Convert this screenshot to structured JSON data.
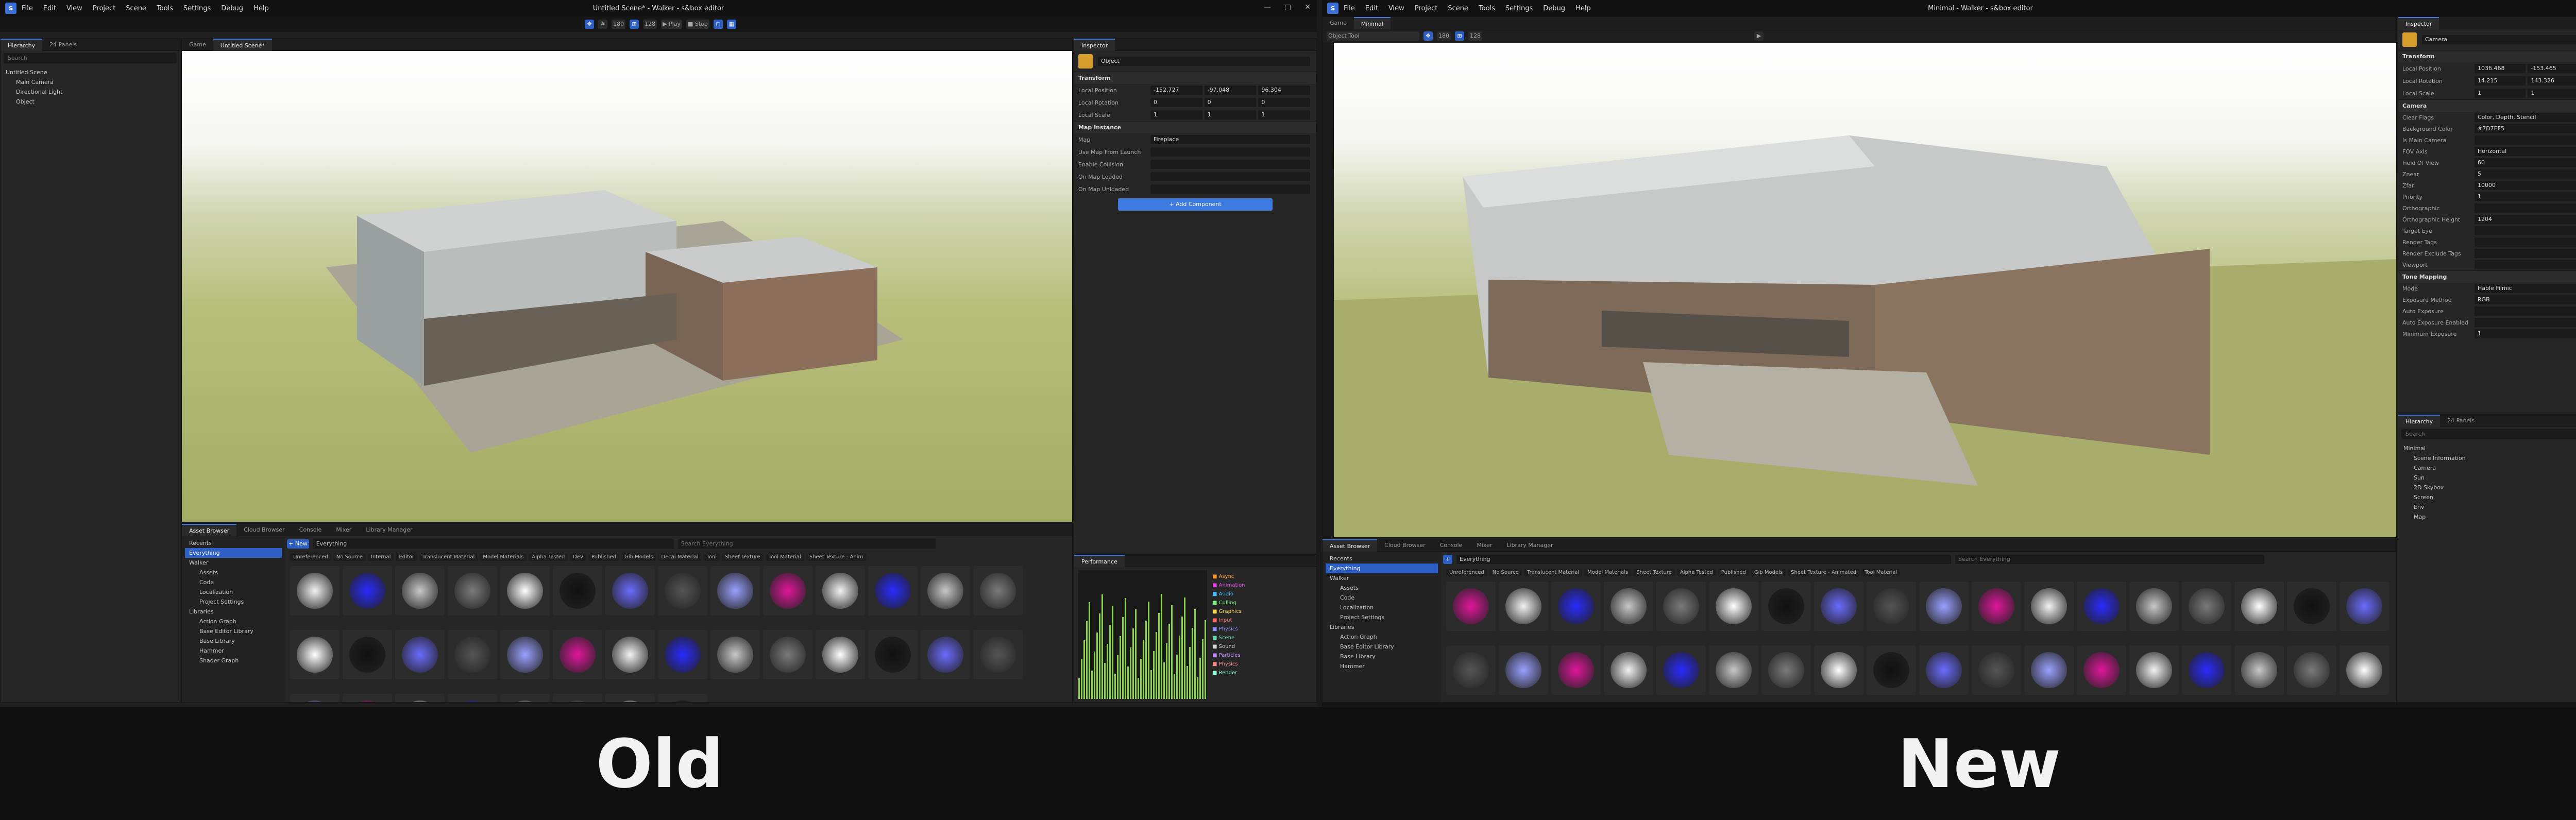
{
  "old": {
    "title": "Untitled Scene* - Walker - s&box editor",
    "menu": [
      "File",
      "Edit",
      "View",
      "Project",
      "Scene",
      "Tools",
      "Settings",
      "Debug",
      "Help"
    ],
    "toolbar": {
      "grid": "180",
      "snap": "128",
      "play": "Play",
      "stop": "Stop"
    },
    "hierarchy": {
      "tab": "Hierarchy",
      "tab2": "24 Panels",
      "search_placeholder": "Search",
      "items": [
        "Untitled Scene",
        "Main Camera",
        "Directional Light",
        "Object"
      ]
    },
    "viewport_tabs": [
      "Game",
      "Untitled Scene*"
    ],
    "inspector": {
      "tab": "Inspector",
      "object_name": "Object",
      "transform_label": "Transform",
      "rows": [
        {
          "label": "Local Position",
          "x": "-152.727",
          "y": "-97.048",
          "z": "96.304"
        },
        {
          "label": "Local Rotation",
          "x": "0",
          "y": "0",
          "z": "0"
        },
        {
          "label": "Local Scale",
          "x": "1",
          "y": "1",
          "z": "1"
        }
      ],
      "map_instance_label": "Map Instance",
      "map_rows": [
        {
          "label": "Map",
          "value": "Fireplace"
        },
        {
          "label": "Use Map From Launch",
          "value": ""
        },
        {
          "label": "Enable Collision",
          "value": ""
        },
        {
          "label": "On Map Loaded",
          "value": ""
        },
        {
          "label": "On Map Unloaded",
          "value": ""
        }
      ],
      "add_component": "+ Add Component"
    },
    "asset_browser": {
      "tabs": [
        "Asset Browser",
        "Cloud Browser",
        "Console",
        "Mixer",
        "Library Manager"
      ],
      "left": [
        "Recents",
        "Everything",
        "Walker",
        "Assets",
        "Code",
        "Localization",
        "Project Settings",
        "Libraries",
        "Action Graph",
        "Base Editor Library",
        "Base Library",
        "Hammer",
        "Shader Graph"
      ],
      "path": "Everything",
      "search_placeholder": "Search Everything",
      "filters": [
        "Unreferenced",
        "No Source",
        "Internal",
        "Editor",
        "Translucent Material",
        "Model Materials",
        "Alpha Tested",
        "Dev",
        "Published",
        "Gib Models",
        "Decal Material",
        "Tool",
        "Sheet Texture",
        "Tool Material",
        "Sheet Texture - Anim"
      ]
    },
    "performance": {
      "tab": "Performance",
      "legend": [
        "Async",
        "Animation",
        "Audio",
        "Culling",
        "Graphics",
        "Input",
        "Physics",
        "Scene",
        "Sound",
        "Particles",
        "Physics",
        "Render"
      ]
    },
    "caption": "Old"
  },
  "new": {
    "title": "Minimal - Walker - s&box editor",
    "menu": [
      "File",
      "Edit",
      "View",
      "Project",
      "Scene",
      "Tools",
      "Settings",
      "Debug",
      "Help"
    ],
    "viewport_tabs": [
      "Game",
      "Minimal"
    ],
    "tool_label": "Object Tool",
    "toolbar": {
      "grid": "180",
      "snap": "128"
    },
    "inspector": {
      "tab": "Inspector",
      "object_name": "Camera",
      "transform_label": "Transform",
      "rows": [
        {
          "label": "Local Position",
          "x": "1036.468",
          "y": "-153.465",
          "z": "1040.75"
        },
        {
          "label": "Local Rotation",
          "x": "14.215",
          "y": "143.326",
          "z": "0"
        },
        {
          "label": "Local Scale",
          "x": "1",
          "y": "1",
          "z": "1"
        }
      ],
      "camera_label": "Camera",
      "camera_rows": [
        {
          "label": "Clear Flags",
          "value": "Color, Depth, Stencil"
        },
        {
          "label": "Background Color",
          "value": "#7D7EF5"
        },
        {
          "label": "Is Main Camera",
          "value": ""
        },
        {
          "label": "FOV Axis",
          "value": "Horizontal"
        },
        {
          "label": "Field Of View",
          "value": "60"
        },
        {
          "label": "Znear",
          "value": "5"
        },
        {
          "label": "Zfar",
          "value": "10000"
        },
        {
          "label": "Priority",
          "value": "1"
        },
        {
          "label": "Orthographic",
          "value": ""
        },
        {
          "label": "Orthographic Height",
          "value": "1204"
        },
        {
          "label": "Target Eye",
          "value": ""
        },
        {
          "label": "Render Tags",
          "value": ""
        },
        {
          "label": "Render Exclude Tags",
          "value": ""
        },
        {
          "label": "Viewport",
          "value": ""
        }
      ],
      "tonemap_label": "Tone Mapping",
      "tonemap_rows": [
        {
          "label": "Mode",
          "value": "Hable Filmic"
        },
        {
          "label": "Exposure Method",
          "value": "RGB"
        },
        {
          "label": "Auto Exposure",
          "value": ""
        },
        {
          "label": "Auto Exposure Enabled",
          "value": ""
        },
        {
          "label": "Minimum Exposure",
          "value": "1"
        }
      ]
    },
    "hierarchy": {
      "tab": "Hierarchy",
      "tab2": "24 Panels",
      "search_placeholder": "Search",
      "items": [
        "Minimal",
        "Scene Information",
        "Camera",
        "Sun",
        "2D Skybox",
        "Screen",
        "Env",
        "Map"
      ]
    },
    "asset_browser": {
      "tabs": [
        "Asset Browser",
        "Cloud Browser",
        "Console",
        "Mixer",
        "Library Manager"
      ],
      "left": [
        "Recents",
        "Everything",
        "Walker",
        "Assets",
        "Code",
        "Localization",
        "Project Settings",
        "Libraries",
        "Action Graph",
        "Base Editor Library",
        "Base Library",
        "Hammer"
      ],
      "path": "Everything",
      "search_placeholder": "Search Everything",
      "filters": [
        "Unreferenced",
        "No Source",
        "Translucent Material",
        "Model Materials",
        "Sheet Texture",
        "Alpha Tested",
        "Published",
        "Gib Models",
        "Sheet Texture - Animated",
        "Tool Material"
      ]
    },
    "caption": "New"
  }
}
